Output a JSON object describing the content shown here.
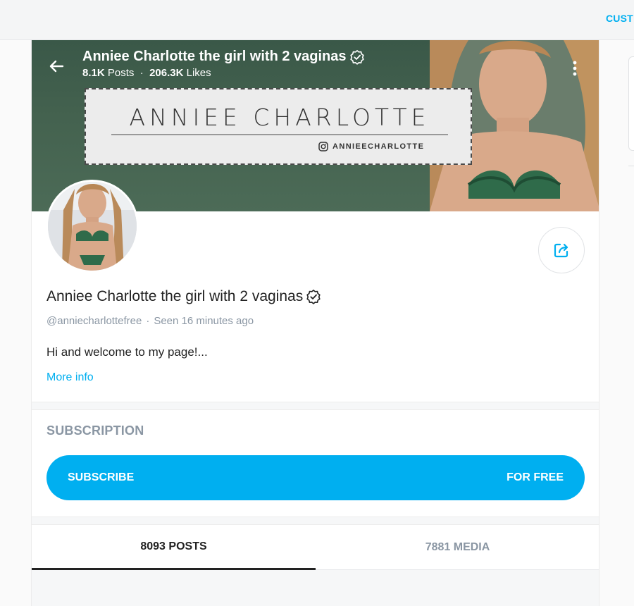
{
  "topbar": {
    "cust_label": "CUST"
  },
  "profile": {
    "display_name": "Anniee Charlotte the girl with 2 vaginas",
    "posts_count": "8.1K",
    "posts_label": "Posts",
    "likes_count": "206.3K",
    "likes_label": "Likes",
    "handle": "@anniecharlottefree",
    "last_seen": "Seen 16 minutes ago",
    "bio": "Hi and welcome to my page!...",
    "more_info": "More info"
  },
  "banner": {
    "name": "ANNIEE CHARLOTTE",
    "instagram": "ANNIEECHARLOTTE"
  },
  "subscription": {
    "heading": "SUBSCRIPTION",
    "button_label": "SUBSCRIBE",
    "price_label": "FOR FREE"
  },
  "tabs": [
    {
      "label": "8093 POSTS",
      "active": true
    },
    {
      "label": "7881 MEDIA",
      "active": false
    }
  ],
  "colors": {
    "accent": "#00aff0",
    "cover_green": "#44624f",
    "muted": "#8a96a3"
  },
  "icons": [
    "back-arrow-icon",
    "verified-icon",
    "kebab-menu-icon",
    "share-icon",
    "instagram-icon"
  ]
}
